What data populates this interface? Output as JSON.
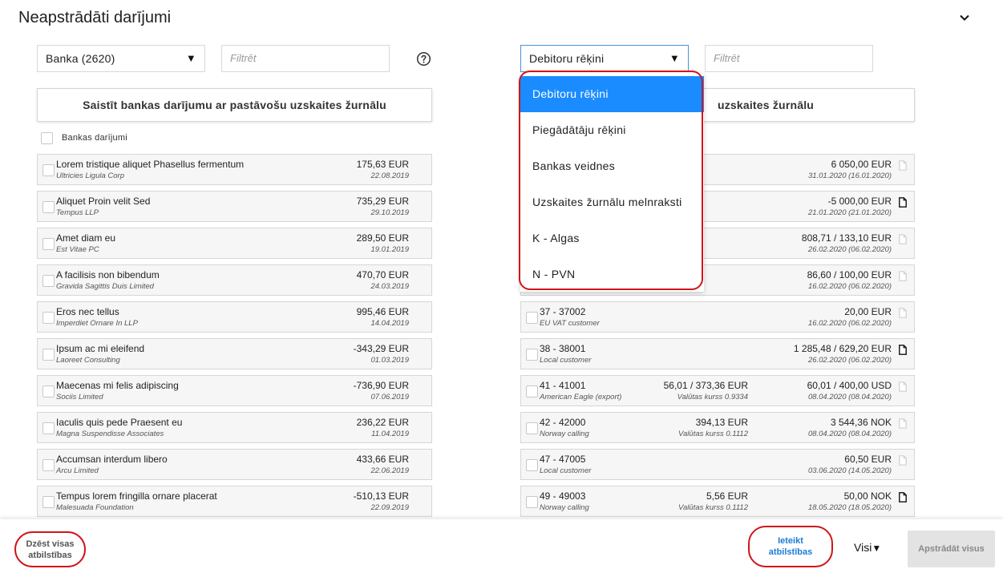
{
  "page": {
    "title": "Neapstrādāti darījumi",
    "collapse_icon": "chevron-down-icon"
  },
  "left": {
    "account_select": "Banka (2620)",
    "filter_placeholder": "Filtrēt",
    "help_icon": "question-circle-icon",
    "header": "Saistīt bankas darījumu ar pastāvošu uzskaites žurnālu",
    "select_all_label": "Bankas darījumi",
    "rows": [
      {
        "title": "Lorem tristique aliquet Phasellus fermentum",
        "sub": "Ultricies Ligula Corp",
        "amount": "175,63 EUR",
        "date": "22.08.2019"
      },
      {
        "title": "Aliquet Proin velit Sed",
        "sub": "Tempus LLP",
        "amount": "735,29 EUR",
        "date": "29.10.2019"
      },
      {
        "title": "Amet diam eu",
        "sub": "Est Vitae PC",
        "amount": "289,50 EUR",
        "date": "19.01.2019"
      },
      {
        "title": "A facilisis non bibendum",
        "sub": "Gravida Sagittis Duis Limited",
        "amount": "470,70 EUR",
        "date": "24.03.2019"
      },
      {
        "title": "Eros nec tellus",
        "sub": "Imperdiet Ornare In LLP",
        "amount": "995,46 EUR",
        "date": "14.04.2019"
      },
      {
        "title": "Ipsum ac mi eleifend",
        "sub": "Laoreet Consulting",
        "amount": "-343,29 EUR",
        "date": "01.03.2019"
      },
      {
        "title": "Maecenas mi felis adipiscing",
        "sub": "Sociis Limited",
        "amount": "-736,90 EUR",
        "date": "07.06.2019"
      },
      {
        "title": "Iaculis quis pede Praesent eu",
        "sub": "Magna Suspendisse Associates",
        "amount": "236,22 EUR",
        "date": "11.04.2019"
      },
      {
        "title": "Accumsan interdum libero",
        "sub": "Arcu Limited",
        "amount": "433,66 EUR",
        "date": "22.06.2019"
      },
      {
        "title": "Tempus lorem fringilla ornare placerat",
        "sub": "Malesuada Foundation",
        "amount": "-510,13 EUR",
        "date": "22.09.2019"
      }
    ]
  },
  "right": {
    "type_select": "Debitoru rēķini",
    "filter_placeholder": "Filtrēt",
    "header_visible_part": "uzskaites žurnālu",
    "rows": [
      {
        "title": "",
        "sub": "",
        "mid_amount": "",
        "mid_rate": "",
        "amount": "6 050,00 EUR",
        "date": "31.01.2020 (16.01.2020)",
        "doc": "document-outline-icon"
      },
      {
        "title": "",
        "sub": "",
        "mid_amount": "",
        "mid_rate": "",
        "amount": "-5 000,00 EUR",
        "date": "21.01.2020 (21.01.2020)",
        "doc": "document-filled-icon"
      },
      {
        "title": "",
        "sub": "",
        "mid_amount": "",
        "mid_rate": "",
        "amount": "808,71 / 133,10 EUR",
        "date": "26.02.2020 (06.02.2020)",
        "doc": "document-outline-icon"
      },
      {
        "title": "",
        "sub": "",
        "mid_amount": "",
        "mid_rate": "",
        "amount": "86,60 / 100,00 EUR",
        "date": "16.02.2020 (06.02.2020)",
        "doc": "document-outline-icon"
      },
      {
        "title": "37 - 37002",
        "sub": "EU VAT customer",
        "mid_amount": "",
        "mid_rate": "",
        "amount": "20,00 EUR",
        "date": "16.02.2020 (06.02.2020)",
        "doc": "document-outline-icon"
      },
      {
        "title": "38 - 38001",
        "sub": "Local customer",
        "mid_amount": "",
        "mid_rate": "",
        "amount": "1 285,48 / 629,20 EUR",
        "date": "26.02.2020 (06.02.2020)",
        "doc": "document-filled-icon"
      },
      {
        "title": "41 - 41001",
        "sub": "American Eagle (export)",
        "mid_amount": "56,01 / 373,36 EUR",
        "mid_rate": "Valūtas kurss 0.9334",
        "amount": "60,01 / 400,00 USD",
        "date": "08.04.2020 (08.04.2020)",
        "doc": "document-outline-icon"
      },
      {
        "title": "42 - 42000",
        "sub": "Norway calling",
        "mid_amount": "394,13 EUR",
        "mid_rate": "Valūtas kurss 0.1112",
        "amount": "3 544,36 NOK",
        "date": "08.04.2020 (08.04.2020)",
        "doc": "document-outline-icon"
      },
      {
        "title": "47 - 47005",
        "sub": "Local customer",
        "mid_amount": "",
        "mid_rate": "",
        "amount": "60,50 EUR",
        "date": "03.06.2020 (14.05.2020)",
        "doc": "document-outline-icon"
      },
      {
        "title": "49 - 49003",
        "sub": "Norway calling",
        "mid_amount": "5,56 EUR",
        "mid_rate": "Valūtas kurss 0.1112",
        "amount": "50,00 NOK",
        "date": "18.05.2020 (18.05.2020)",
        "doc": "document-filled-icon"
      }
    ]
  },
  "dropdown": {
    "options": [
      "Debitoru rēķini",
      "Piegādātāju rēķini",
      "Bankas veidnes",
      "Uzskaites žurnālu melnraksti",
      "K - Algas",
      "N - PVN"
    ],
    "selected_index": 0
  },
  "bottom": {
    "clear_label_line1": "Dzēst visas",
    "clear_label_line2": "atbilstības",
    "suggest_label_line1": "Ieteikt",
    "suggest_label_line2": "atbilstības",
    "all_select_label": "Visi",
    "process_label": "Apstrādāt visus"
  },
  "colors": {
    "accent_blue": "#1a8cff",
    "highlight_red": "#d0151b",
    "link_blue": "#1a7bd6"
  }
}
